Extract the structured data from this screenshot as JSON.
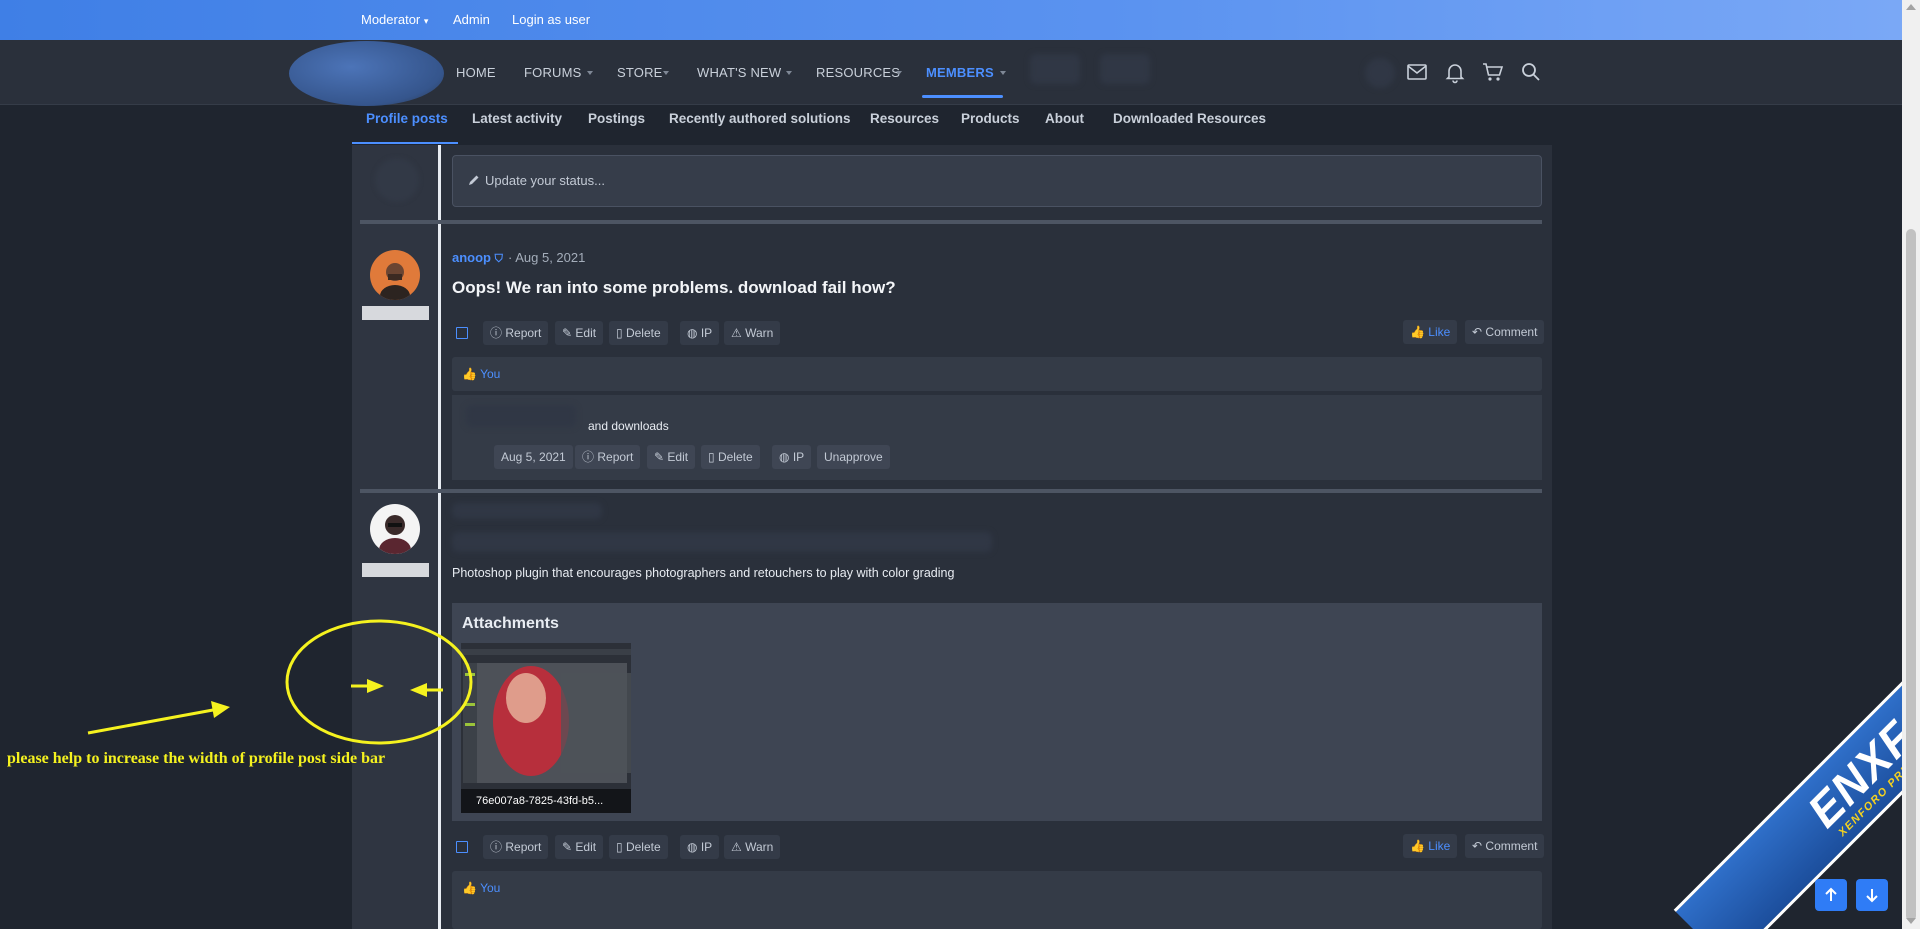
{
  "staff_bar": {
    "moderator_label": "Moderator",
    "admin_label": "Admin",
    "login_as_user_label": "Login as user"
  },
  "nav": {
    "items": [
      {
        "label": "HOME"
      },
      {
        "label": "FORUMS"
      },
      {
        "label": "STORE"
      },
      {
        "label": "WHAT'S NEW"
      },
      {
        "label": "RESOURCES"
      },
      {
        "label": "MEMBERS"
      }
    ],
    "active_index": 5,
    "icons": [
      "mail-icon",
      "bell-icon",
      "cart-icon",
      "search-icon"
    ]
  },
  "tabs": [
    {
      "label": "Profile posts",
      "active": true
    },
    {
      "label": "Latest activity"
    },
    {
      "label": "Postings"
    },
    {
      "label": "Recently authored solutions"
    },
    {
      "label": "Resources"
    },
    {
      "label": "Products"
    },
    {
      "label": "About"
    },
    {
      "label": "Downloaded Resources"
    }
  ],
  "status": {
    "placeholder": "Update your status..."
  },
  "post1": {
    "author": "anoop",
    "date": "Aug 5, 2021",
    "title": "Oops! We ran into some problems. download fail how?",
    "actions": [
      "Report",
      "Edit",
      "Delete",
      "IP",
      "Warn"
    ],
    "like_label": "Like",
    "comment_label": "Comment",
    "likes_text": "You",
    "comment": {
      "text": "and downloads",
      "date": "Aug 5, 2021",
      "actions": [
        "Report",
        "Edit",
        "Delete",
        "IP",
        "Unapprove"
      ]
    }
  },
  "post2": {
    "body": "Photoshop plugin that encourages photographers and retouchers to play with color grading",
    "attachments_title": "Attachments",
    "attachment_name": "76e007a8-7825-43fd-b5...",
    "actions": [
      "Report",
      "Edit",
      "Delete",
      "IP",
      "Warn"
    ],
    "like_label": "Like",
    "comment_label": "Comment",
    "likes_text": "You"
  },
  "annotation": {
    "text": "please help to increase the width of profile post side bar"
  },
  "watermark": {
    "main": "ENXF.NET",
    "sub": "XENFORO PREMIUM COMMUNITY"
  },
  "colors": {
    "accent": "#4c8fff",
    "staff_bar": "#5b93f0",
    "annotation": "#f5f21f"
  }
}
